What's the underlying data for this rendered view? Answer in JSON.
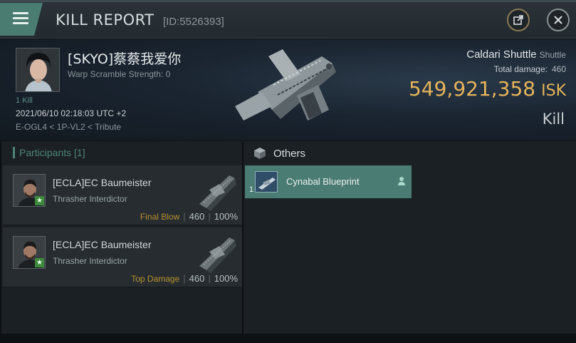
{
  "header": {
    "title": "KILL REPORT",
    "report_id": "[ID:5526393]"
  },
  "victim": {
    "name": "[SKYO]蔡蔡我爱你",
    "warp_scramble": "Warp Scramble Strength: 0",
    "kills_badge": "1 Kill",
    "kill_time": "2021/06/10 02:18:03 UTC +2",
    "location": "E-OGL4 < 1P-VL2 < Tribute",
    "ship_name": "Caldari Shuttle",
    "ship_class": "Shuttle",
    "total_damage_label": "Total damage:",
    "total_damage_value": "460",
    "isk_value": "549,921,358",
    "isk_unit": "ISK",
    "result_label": "Kill"
  },
  "participants": {
    "heading": "Participants [1]",
    "rows": [
      {
        "name": "[ECLA]EC Baumeister",
        "ship": "Thrasher Interdictor",
        "role": "Final Blow",
        "damage": "460",
        "percent": "100%"
      },
      {
        "name": "[ECLA]EC Baumeister",
        "ship": "Thrasher Interdictor",
        "role": "Top Damage",
        "damage": "460",
        "percent": "100%"
      }
    ]
  },
  "others": {
    "heading": "Others",
    "items": [
      {
        "quantity": "1",
        "name": "Cynabal Blueprint"
      }
    ]
  },
  "colors": {
    "accent": "#4a7c72",
    "isk": "#e5b45a",
    "role": "#b8922f"
  }
}
